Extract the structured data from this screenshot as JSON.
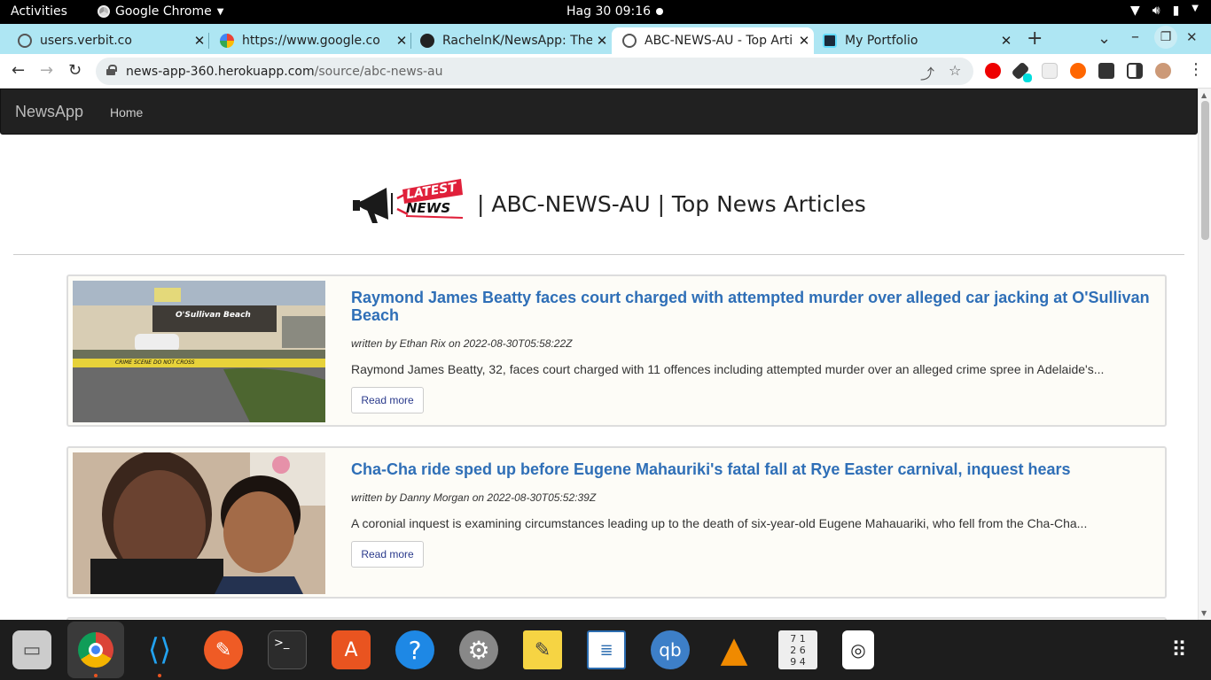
{
  "system": {
    "activities": "Activities",
    "app_name": "Google Chrome",
    "clock": "Hag 30  09:16"
  },
  "tabs": [
    {
      "title": "users.verbit.co",
      "close": "✕"
    },
    {
      "title": "https://www.google.co",
      "close": "✕"
    },
    {
      "title": "RachelnK/NewsApp: The",
      "close": "✕"
    },
    {
      "title": "ABC-NEWS-AU - Top Arti",
      "close": "✕"
    },
    {
      "title": "My Portfolio",
      "close": "✕"
    }
  ],
  "tab_controls": {
    "new_tab": "+",
    "list": "⌄",
    "minimize": "–",
    "restore": "❐",
    "close": "✕"
  },
  "nav": {
    "back": "←",
    "forward": "→",
    "reload": "↻"
  },
  "url": {
    "host": "news-app-360.herokuapp.com",
    "path": "/source/abc-news-au"
  },
  "site": {
    "brand": "NewsApp",
    "home": "Home",
    "logo_text_1": "LATEST",
    "logo_text_2": "NEWS",
    "heading": "| ABC-NEWS-AU | Top News Articles"
  },
  "articles": [
    {
      "title": "Raymond James Beatty faces court charged with attempted murder over alleged car jacking at O'Sullivan Beach",
      "meta": "written by Ethan Rix on 2022-08-30T05:58:22Z",
      "description": "Raymond James Beatty, 32, faces court charged with 11 offences including attempted murder over an alleged crime spree in Adelaide's...",
      "button": "Read more",
      "image_sign": "O'Sullivan  Beach",
      "tape_text": "CRIME SCENE DO NOT CROSS"
    },
    {
      "title": "Cha-Cha ride sped up before Eugene Mahauriki's fatal fall at Rye Easter carnival, inquest hears",
      "meta": "written by Danny Morgan on 2022-08-30T05:52:39Z",
      "description": "A coronial inquest is examining circumstances leading up to the death of six-year-old Eugene Mahauariki, who fell from the Cha-Cha...",
      "button": "Read more"
    }
  ],
  "dock": [
    "files",
    "chrome",
    "vscode",
    "postman",
    "terminal",
    "software-center",
    "help",
    "settings",
    "notes",
    "writer",
    "qbittorrent",
    "vlc",
    "sudoku",
    "player",
    "apps-grid"
  ]
}
